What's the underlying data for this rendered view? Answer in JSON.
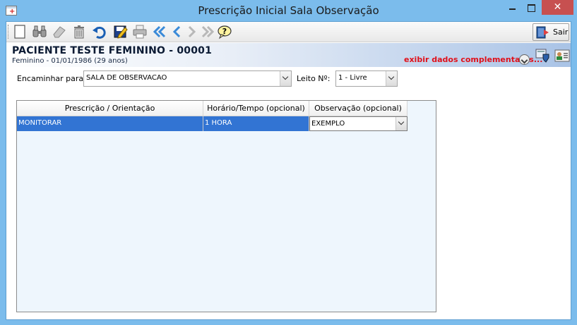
{
  "window": {
    "title": "Prescrição Inicial Sala Observação",
    "close_glyph": "✕"
  },
  "toolbar": {
    "buttons": [
      "new-icon",
      "binoculars-icon",
      "eraser-icon",
      "trash-icon",
      "undo-icon",
      "edit-save-icon",
      "print-icon",
      "first-record-icon",
      "previous-record-icon",
      "next-record-icon",
      "last-record-icon",
      "help-icon"
    ],
    "exit_label": "Sair"
  },
  "patient": {
    "name": "PACIENTE TESTE FEMININO - 00001",
    "info": "Feminino - 01/01/1986 (29 anos)",
    "extra_link": "exibir dados complementares..."
  },
  "form": {
    "forward_label": "Encaminhar para:",
    "forward_value": "SALA DE OBSERVACAO",
    "bed_label": "Leito Nº:",
    "bed_value": "1 - Livre"
  },
  "grid": {
    "columns": [
      "Prescrição / Orientação",
      "Horário/Tempo (opcional)",
      "Observação (opcional)"
    ],
    "rows": [
      {
        "prescription": "MONITORAR",
        "time": "1 HORA",
        "observation": "EXEMPLO"
      }
    ]
  },
  "colors": {
    "titlebar": "#7bbcec",
    "close_button": "#c75050",
    "selection": "#3274d3",
    "link_red": "#e0101a"
  }
}
